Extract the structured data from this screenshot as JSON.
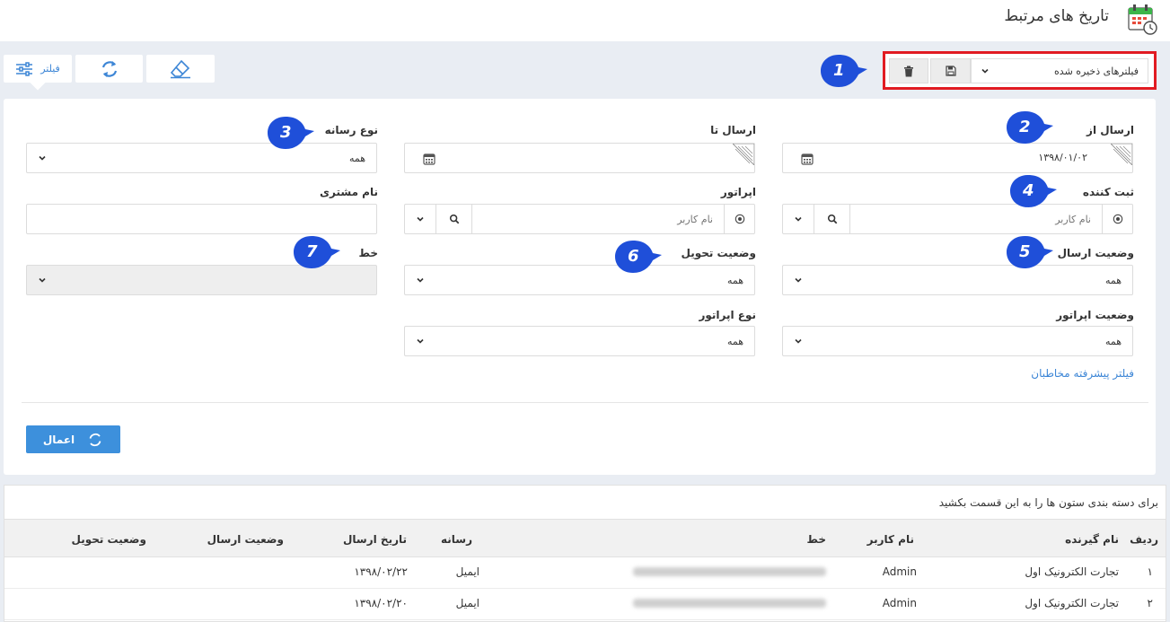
{
  "header": {
    "title": "تاریخ های مرتبط"
  },
  "toolbar": {
    "filter_label": "فیلتر"
  },
  "saved_filters": {
    "label": "فیلترهای ذخیره شده"
  },
  "filters": {
    "send_from": {
      "label": "ارسال از",
      "value": "۱۳۹۸/۰۱/۰۲"
    },
    "send_to": {
      "label": "ارسال تا",
      "value": ""
    },
    "media_type": {
      "label": "نوع رسانه",
      "value": "همه"
    },
    "registrar": {
      "label": "ثبت کننده",
      "placeholder": "نام کاربر"
    },
    "operator": {
      "label": "اپراتور",
      "placeholder": "نام کاربر"
    },
    "customer_name": {
      "label": "نام مشتری",
      "value": ""
    },
    "send_status": {
      "label": "وضعیت ارسال",
      "value": "همه"
    },
    "delivery_status": {
      "label": "وضعیت تحویل",
      "value": "همه"
    },
    "line": {
      "label": "خط",
      "value": ""
    },
    "operator_status": {
      "label": "وضعیت اپراتور",
      "value": "همه"
    },
    "operator_type": {
      "label": "نوع اپراتور",
      "value": "همه"
    },
    "advanced_link": "فیلتر پیشرفته مخاطبان",
    "apply_label": "اعمال"
  },
  "markers": [
    "1",
    "2",
    "3",
    "4",
    "5",
    "6",
    "7"
  ],
  "grid": {
    "group_hint": "برای دسته بندی ستون ها را به این قسمت بکشید",
    "columns": [
      "ردیف",
      "نام گیرنده",
      "نام کاربر",
      "خط",
      "رسانه",
      "تاریخ ارسال",
      "وضعیت ارسال",
      "وضعیت تحویل"
    ],
    "rows": [
      {
        "index": "۱",
        "recipient": "تجارت الکترونیک اول",
        "user": "Admin",
        "media": "ایمیل",
        "date": "۱۳۹۸/۰۲/۲۲"
      },
      {
        "index": "۲",
        "recipient": "تجارت الکترونیک اول",
        "user": "Admin",
        "media": "ایمیل",
        "date": "۱۳۹۸/۰۲/۲۰"
      }
    ]
  },
  "colors": {
    "accent": "#3d86d6",
    "highlight": "#e11b22",
    "marker": "#1f4fd9"
  }
}
